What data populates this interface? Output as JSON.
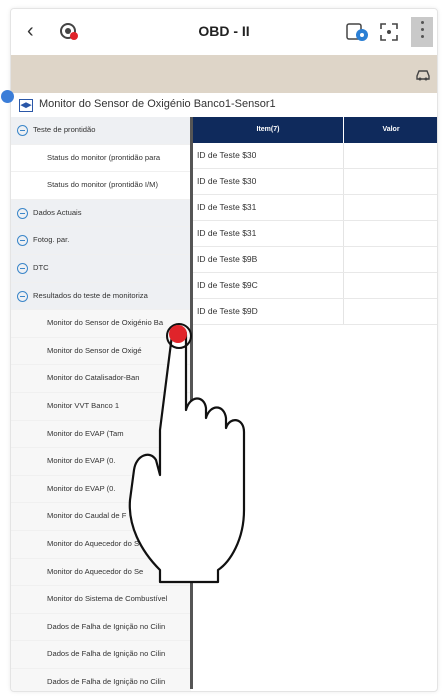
{
  "header": {
    "title": "OBD - II",
    "back_icon": "back-arrow-icon",
    "vci_icon": "vci-connection-icon",
    "icons": [
      "record-icon",
      "screenshot-icon",
      "more-icon"
    ]
  },
  "band": {
    "icon": "vehicle-icon"
  },
  "panel": {
    "title": "Monitor do Sensor de Oxigénio Banco1-Sensor1"
  },
  "tree": [
    {
      "type": "sec",
      "label": "Teste de prontidão"
    },
    {
      "type": "sub",
      "label": "Status do monitor (prontidão para"
    },
    {
      "type": "sub",
      "label": "Status do monitor (prontidão I/M)"
    },
    {
      "type": "sec",
      "label": "Dados Actuais"
    },
    {
      "type": "sec",
      "label": "Fotog. par."
    },
    {
      "type": "sec",
      "label": "DTC"
    },
    {
      "type": "sec",
      "label": "Resultados do teste de monitoriza"
    },
    {
      "type": "item",
      "label": "Monitor do Sensor de Oxigénio Ba"
    },
    {
      "type": "item",
      "label": "Monitor do Sensor de Oxigé"
    },
    {
      "type": "item",
      "label": "Monitor do Catalisador-Ban"
    },
    {
      "type": "item",
      "label": "Monitor VVT Banco 1"
    },
    {
      "type": "item",
      "label": "Monitor do EVAP (Tam"
    },
    {
      "type": "item",
      "label": "Monitor do EVAP (0."
    },
    {
      "type": "item",
      "label": "Monitor do EVAP (0."
    },
    {
      "type": "item",
      "label": "Monitor do Caudal de F"
    },
    {
      "type": "item",
      "label": "Monitor do Aquecedor do S"
    },
    {
      "type": "item",
      "label": "Monitor do Aquecedor do Se"
    },
    {
      "type": "item",
      "label": "Monitor do Sistema de Combustível"
    },
    {
      "type": "item",
      "label": "Dados de Falha de Ignição no Cilin"
    },
    {
      "type": "item",
      "label": "Dados de Falha de Ignição no Cilin"
    },
    {
      "type": "item",
      "label": "Dados de Falha de Ignição no Cilin"
    }
  ],
  "table": {
    "headers": [
      "Item(7)",
      "Valor"
    ],
    "rows": [
      [
        "ID de Teste $30",
        ""
      ],
      [
        "ID de Teste $30",
        ""
      ],
      [
        "ID de Teste $31",
        ""
      ],
      [
        "ID de Teste $31",
        ""
      ],
      [
        "ID de Teste $9B",
        ""
      ],
      [
        "ID de Teste $9C",
        ""
      ],
      [
        "ID de Teste $9D",
        ""
      ]
    ]
  },
  "colors": {
    "table_header": "#0f2a5c",
    "band": "#ded5c8",
    "section_bg": "#eef0f3",
    "touch_indicator": "#e0242a",
    "accent_blue": "#3b7dd8"
  }
}
